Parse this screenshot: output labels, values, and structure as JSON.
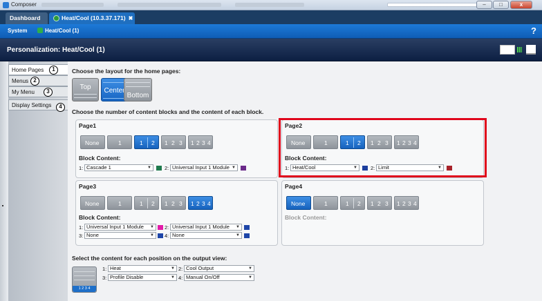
{
  "window": {
    "app_title": "Composer"
  },
  "tabs": [
    {
      "label": "Dashboard"
    },
    {
      "label": "Heat/Cool (10.3.37.171)"
    }
  ],
  "nav": {
    "system": "System",
    "device": "Heat/Cool (1)",
    "help_icon": "?"
  },
  "header": {
    "title": "Personalization: Heat/Cool (1)"
  },
  "menu": [
    {
      "label": "Home Pages",
      "num": "1"
    },
    {
      "label": "Menus",
      "num": "2"
    },
    {
      "label": "My Menu",
      "num": "3"
    },
    {
      "label": "Display Settings",
      "num": "4"
    }
  ],
  "layout": {
    "title": "Choose the layout for the home pages:",
    "options": [
      "Top",
      "Center",
      "Bottom"
    ],
    "selected": "Center"
  },
  "blocks_title": "Choose the number of content blocks and the content of each block.",
  "block_counts": [
    "None",
    "1",
    "1",
    "2",
    "1",
    "2",
    "3",
    "1",
    "2",
    "3",
    "4"
  ],
  "block_content_label": "Block Content:",
  "pages": [
    {
      "title": "Page1",
      "selected": "2",
      "slots": [
        {
          "num": "1:",
          "value": "Cascade 1",
          "color": "#1f7a4d"
        },
        {
          "num": "2:",
          "value": "Universal Input 1 Module",
          "color": "#6b2a8a"
        }
      ]
    },
    {
      "title": "Page2",
      "selected": "2",
      "slots": [
        {
          "num": "1:",
          "value": "Heat/Cool",
          "color": "#1d3f9e"
        },
        {
          "num": "2:",
          "value": "Limit",
          "color": "#a8232a"
        }
      ]
    },
    {
      "title": "Page3",
      "selected": "4",
      "slots": [
        {
          "num": "1:",
          "value": "Universal Input 1 Module",
          "color": "#e21ca8"
        },
        {
          "num": "2:",
          "value": "Universal Input 1 Module",
          "color": "#1e46a8"
        },
        {
          "num": "3:",
          "value": "None",
          "color": "#1e46a8"
        },
        {
          "num": "4:",
          "value": "None",
          "color": "#1e46a8"
        }
      ]
    },
    {
      "title": "Page4",
      "selected": "None",
      "slots": []
    }
  ],
  "output": {
    "title": "Select the content for each position on the output view:",
    "thumb_label": "1 2 3 4",
    "slots": [
      {
        "num": "1:",
        "value": "Heat"
      },
      {
        "num": "2:",
        "value": "Cool Output"
      },
      {
        "num": "3:",
        "value": "Profile Disable"
      },
      {
        "num": "4:",
        "value": "Manual On/Off"
      }
    ]
  }
}
